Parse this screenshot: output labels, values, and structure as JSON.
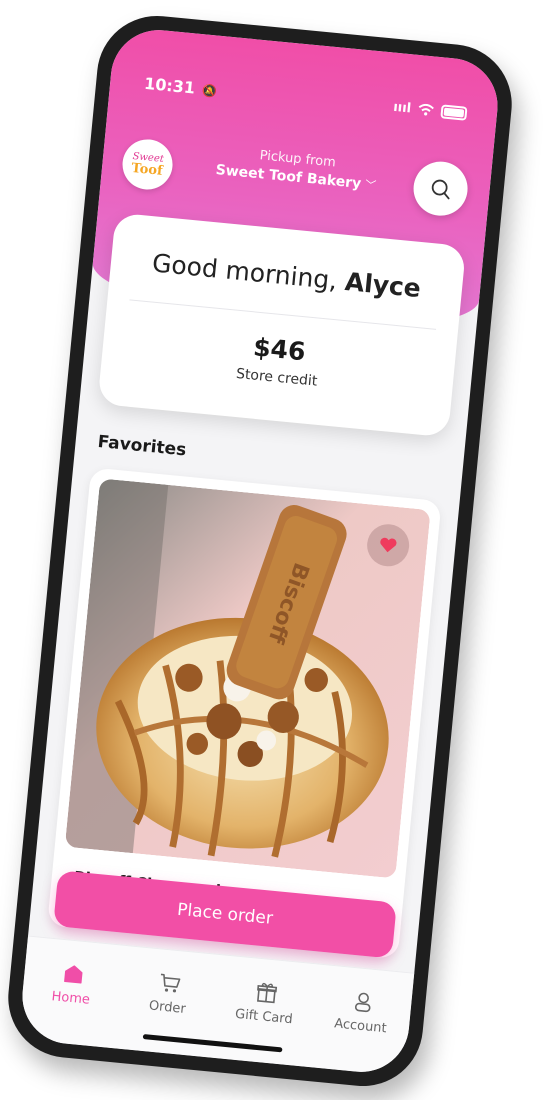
{
  "status_bar": {
    "time": "10:31",
    "bell": "🔕",
    "signal": "ıııl"
  },
  "header": {
    "logo_line1": "Sweet",
    "logo_line2": "Toof",
    "pickup_label": "Pickup from",
    "store_name": "Sweet Toof Bakery",
    "chevron": "﹀",
    "search_icon": "search-icon"
  },
  "welcome_card": {
    "greeting_prefix": "Good morning,",
    "user_name": "Alyce",
    "credit_amount": "$46",
    "credit_label": "Store credit"
  },
  "favorites": {
    "title": "Favorites",
    "items": [
      {
        "name": "Biscoff Cheesecake",
        "favorited": true
      }
    ]
  },
  "cta": {
    "label": "Place order"
  },
  "tabbar": {
    "tabs": [
      {
        "label": "Home",
        "icon": "home-icon",
        "active": true
      },
      {
        "label": "Order",
        "icon": "cart-icon",
        "active": false
      },
      {
        "label": "Gift Card",
        "icon": "gift-icon",
        "active": false
      },
      {
        "label": "Account",
        "icon": "person-icon",
        "active": false
      }
    ]
  },
  "colors": {
    "accent": "#f04ea8",
    "header_bottom": "#e27ad3",
    "background": "#f4f4f6"
  }
}
